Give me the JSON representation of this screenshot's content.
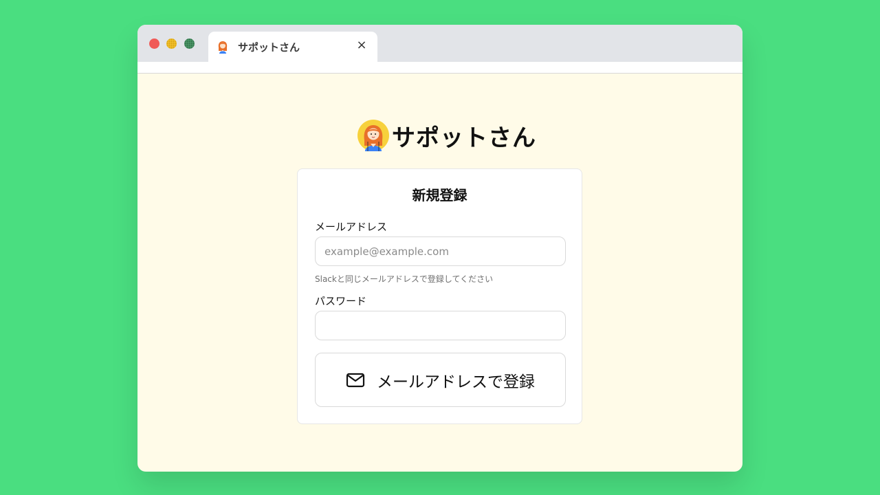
{
  "browser": {
    "tab": {
      "title": "サポットさん",
      "icon": "avatar-icon",
      "close_icon": "close-icon",
      "close_glyph": "×"
    },
    "traffic_lights": [
      "close",
      "minimize",
      "maximize"
    ]
  },
  "brand": {
    "name": "サポットさん",
    "logo_icon": "avatar-icon"
  },
  "signup": {
    "title": "新規登録",
    "email": {
      "label": "メールアドレス",
      "value": "",
      "placeholder": "example@example.com",
      "hint": "Slackと同じメールアドレスで登録してください"
    },
    "password": {
      "label": "パスワード",
      "value": "",
      "placeholder": ""
    },
    "submit": {
      "label": "メールアドレスで登録",
      "icon": "mail-icon"
    }
  },
  "colors": {
    "page_background": "#4ade80",
    "content_background": "#fffbe8",
    "tabbar_background": "#e2e4e8",
    "traffic_red": "#f05a57",
    "traffic_yellow": "#f2c230",
    "traffic_green": "#4f9a6a"
  }
}
